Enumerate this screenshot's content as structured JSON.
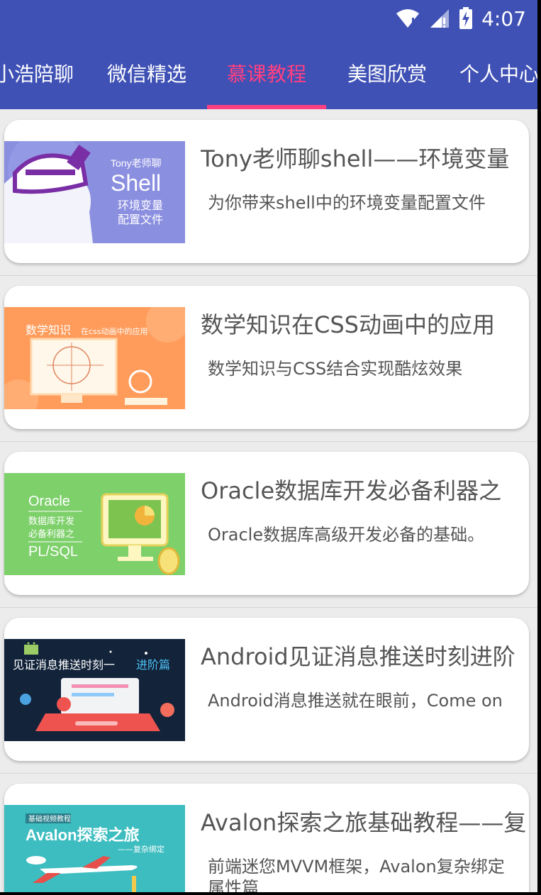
{
  "status_bar": {
    "time": "4:07"
  },
  "tabs": [
    {
      "label": "小浩陪聊"
    },
    {
      "label": "微信精选"
    },
    {
      "label": "慕课教程"
    },
    {
      "label": "美图欣赏"
    },
    {
      "label": "个人中心"
    }
  ],
  "active_tab": "慕课教程",
  "colors": {
    "app_bar": "#3f51b5",
    "accent": "#ff4081",
    "background": "#ececec"
  },
  "courses": [
    {
      "title": "Tony老师聊shell——环境变量",
      "desc": "为你带来shell中的环境变量配置文件",
      "thumb_text": [
        "Tony老师聊",
        "Shell",
        "环境变量",
        "配置文件"
      ]
    },
    {
      "title": "数学知识在CSS动画中的应用",
      "desc": "数学知识与CSS结合实现酷炫效果",
      "thumb_text": [
        "数学知识",
        "在css动画中的应用"
      ]
    },
    {
      "title": "Oracle数据库开发必备利器之",
      "desc": "Oracle数据库高级开发必备的基础。",
      "thumb_text": [
        "Oracle",
        "数据库开发",
        "必备利器之",
        "PL/SQL"
      ]
    },
    {
      "title": "Android见证消息推送时刻进阶",
      "desc": "Android消息推送就在眼前，Come on",
      "thumb_text": [
        "见证消息推送时刻一",
        "进阶篇"
      ]
    },
    {
      "title": "Avalon探索之旅基础教程——复",
      "desc": "前端迷您MVVM框架，Avalon复杂绑定属性篇",
      "thumb_text": [
        "基础视频教程",
        "Avalon探索之旅",
        "——复杂绑定"
      ]
    }
  ]
}
